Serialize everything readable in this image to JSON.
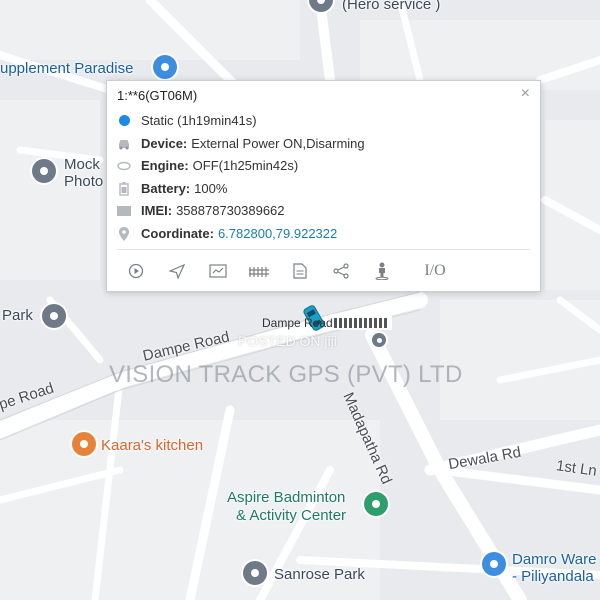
{
  "map": {
    "pois": [
      {
        "id": "hero",
        "label": "(Hero service )"
      },
      {
        "id": "supplement",
        "label": "upplement Paradise"
      },
      {
        "id": "mock1",
        "label": "Mock"
      },
      {
        "id": "mock2",
        "label": "Photo"
      },
      {
        "id": "park",
        "label": "Park"
      },
      {
        "id": "kaara",
        "label": "Kaara's kitchen"
      },
      {
        "id": "aspire1",
        "label": "Aspire Badminton"
      },
      {
        "id": "aspire2",
        "label": "& Activity Center"
      },
      {
        "id": "sanrose",
        "label": "Sanrose Park"
      },
      {
        "id": "damro1",
        "label": "Damro Ware"
      },
      {
        "id": "damro2",
        "label": "- Piliyandala"
      }
    ],
    "roads": {
      "dampe_road_1": "Dampe Road",
      "dampe_road_2": "pe Road",
      "madapatha": "Madapatha Rd",
      "dewala": "Dewala Rd",
      "first_ln": "1st Ln"
    },
    "vehicle_label": "Dampe Road"
  },
  "popup": {
    "title": "1:**6(GT06M)",
    "close": "×",
    "status": "Static (1h19min41s)",
    "device_label": "Device:",
    "device_value": "External Power ON,Disarming",
    "engine_label": "Engine:",
    "engine_value": "OFF(1h25min42s)",
    "battery_label": "Battery:",
    "battery_value": "100%",
    "imei_label": "IMEI:",
    "imei_value": "358878730389662",
    "coord_label": "Coordinate:",
    "coord_value": "6.782800,79.922322",
    "io_label": "I/O"
  },
  "overlay": {
    "watermark": "VISION TRACK GPS (PVT) LTD",
    "posted": "POSTED ON jiji"
  },
  "colors": {
    "accent": "#1a7fa8",
    "status_dot": "#1e88e5"
  }
}
